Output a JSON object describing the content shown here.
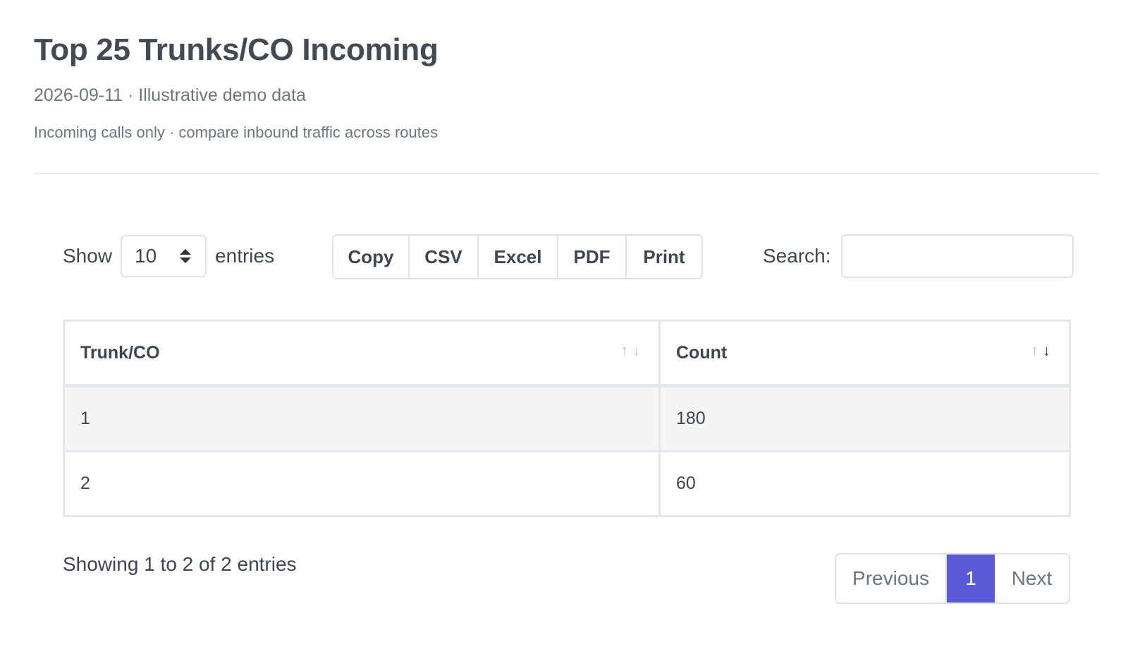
{
  "header": {
    "title": "Top 25 Trunks/CO Incoming",
    "subtitle": "2026-09-11 · Illustrative demo data",
    "caption": "Incoming calls only · compare inbound traffic across routes"
  },
  "length_control": {
    "prefix": "Show",
    "value": "10",
    "suffix": "entries"
  },
  "export_buttons": [
    "Copy",
    "CSV",
    "Excel",
    "PDF",
    "Print"
  ],
  "search": {
    "label": "Search:",
    "value": "",
    "placeholder": ""
  },
  "table": {
    "columns": [
      "Trunk/CO",
      "Count"
    ],
    "sort": {
      "column": "Count",
      "direction": "descending"
    },
    "rows": [
      [
        "1",
        "180"
      ],
      [
        "2",
        "60"
      ]
    ]
  },
  "footer": {
    "info": "Showing 1 to 2 of 2 entries",
    "pagination": {
      "previous": "Previous",
      "current": "1",
      "next": "Next"
    }
  },
  "colors": {
    "accent": "#5a5ad6",
    "text": "#3f4650",
    "muted": "#6b7682",
    "border": "#dfe2e6",
    "row_stripe": "#f5f5f5"
  }
}
